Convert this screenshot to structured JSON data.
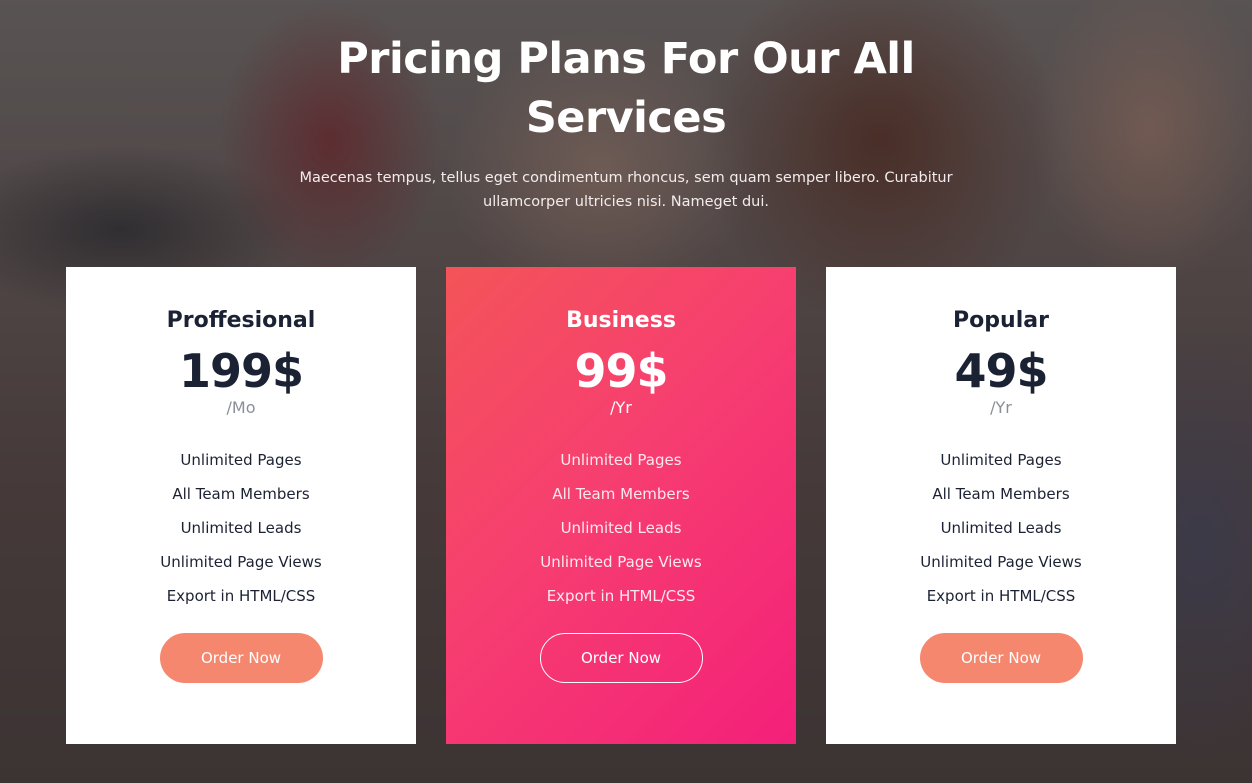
{
  "header": {
    "title": "Pricing Plans For Our All Services",
    "subtitle": "Maecenas tempus, tellus eget condimentum rhoncus, sem quam semper libero. Curabitur ullamcorper ultricies nisi. Nameget dui."
  },
  "colors": {
    "accent_button": "#f6876f",
    "featured_gradient_start": "#f45458",
    "featured_gradient_end": "#f4207a",
    "dark_text": "#1b2234"
  },
  "plans": [
    {
      "name": "Proffesional",
      "price": "199$",
      "period": "/Mo",
      "features": [
        "Unlimited Pages",
        "All Team Members",
        "Unlimited Leads",
        "Unlimited Page Views",
        "Export in HTML/CSS"
      ],
      "button_label": "Order Now"
    },
    {
      "name": "Business",
      "price": "99$",
      "period": "/Yr",
      "features": [
        "Unlimited Pages",
        "All Team Members",
        "Unlimited Leads",
        "Unlimited Page Views",
        "Export in HTML/CSS"
      ],
      "button_label": "Order Now"
    },
    {
      "name": "Popular",
      "price": "49$",
      "period": "/Yr",
      "features": [
        "Unlimited Pages",
        "All Team Members",
        "Unlimited Leads",
        "Unlimited Page Views",
        "Export in HTML/CSS"
      ],
      "button_label": "Order Now"
    }
  ]
}
